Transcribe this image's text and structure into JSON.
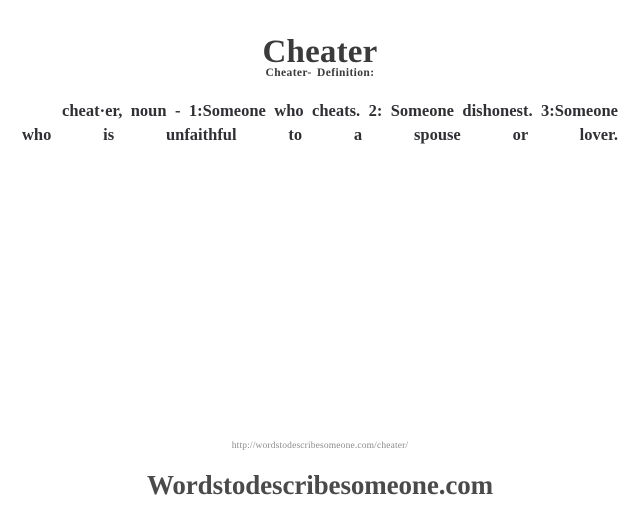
{
  "document": {
    "title": "Cheater",
    "subtitle": "Cheater- Definition:",
    "definition": "cheat·er, noun - 1:Someone who cheats. 2: Someone dishonest.  3:Someone who is unfaithful to a spouse or lover.",
    "footer_url": "http://wordstodescribesomeone.com/cheater/",
    "brand": "Wordstodescribesomeone.com"
  },
  "colors": {
    "background": "#ffffff",
    "title_text": "#3b3b3b",
    "subtitle_text": "#3b3b3b",
    "body_text": "#2f3033",
    "footer_url_text": "#8d8d8d",
    "brand_text": "#4a4a4a"
  }
}
